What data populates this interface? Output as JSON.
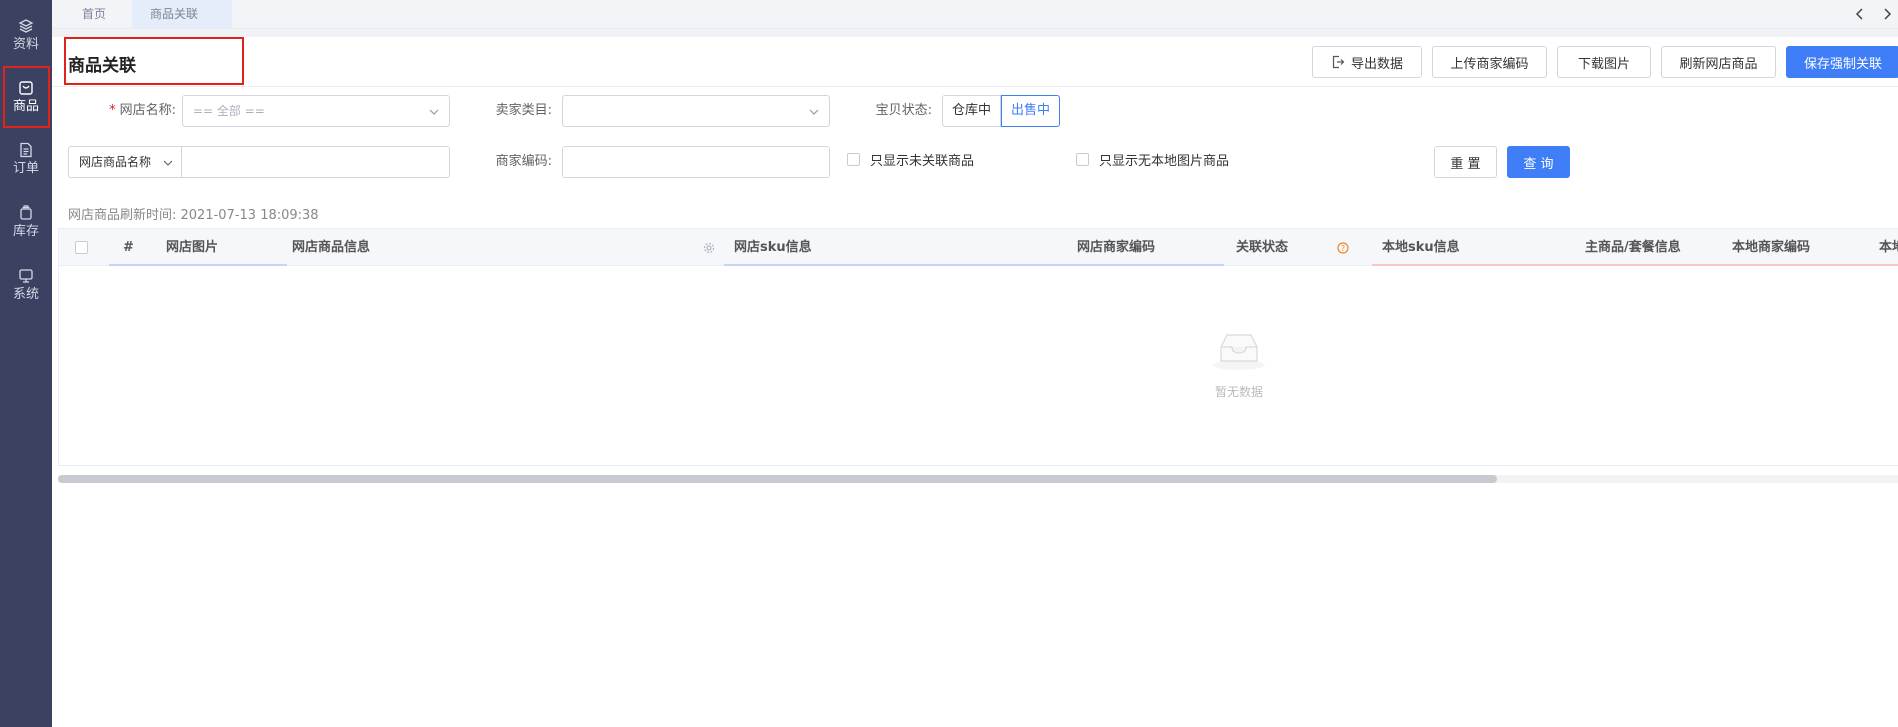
{
  "sidebar": {
    "items": [
      {
        "label": "资料",
        "icon": "layers-icon"
      },
      {
        "label": "商品",
        "icon": "bag-icon",
        "active": true
      },
      {
        "label": "订单",
        "icon": "document-icon"
      },
      {
        "label": "库存",
        "icon": "stack-icon"
      },
      {
        "label": "系统",
        "icon": "monitor-icon"
      }
    ]
  },
  "tabs": [
    {
      "label": "首页"
    },
    {
      "label": "商品关联",
      "active": true
    }
  ],
  "page": {
    "title": "商品关联"
  },
  "toolbar": {
    "export": "导出数据",
    "upload_code": "上传商家编码",
    "download_images": "下载图片",
    "refresh_goods": "刷新网店商品",
    "save_force": "保存强制关联"
  },
  "filters": {
    "shop_name_label": "网店名称:",
    "shop_name_placeholder": "== 全部 ==",
    "seller_category_label": "卖家类目:",
    "seller_category_value": "",
    "status_label": "宝贝状态:",
    "status_options": [
      "仓库中",
      "出售中"
    ],
    "status_selected": "出售中",
    "search_field_select": "网店商品名称",
    "search_value": "",
    "merchant_code_label": "商家编码:",
    "merchant_code_value": "",
    "only_unlinked": "只显示未关联商品",
    "only_no_local_image": "只显示无本地图片商品",
    "reset": "重 置",
    "query": "查 询"
  },
  "refresh_info": "网店商品刷新时间: 2021-07-13 18:09:38",
  "table": {
    "columns": [
      "#",
      "网店图片",
      "网店商品信息",
      "网店sku信息",
      "网店商家编码",
      "关联状态",
      "本地sku信息",
      "主商品/套餐信息",
      "本地商家编码",
      "本地"
    ],
    "rows": [],
    "empty_text": "暂无数据"
  },
  "colors": {
    "sidebar_bg": "#3b4160",
    "primary": "#3f7ef7",
    "highlight_red": "#e0231c"
  }
}
